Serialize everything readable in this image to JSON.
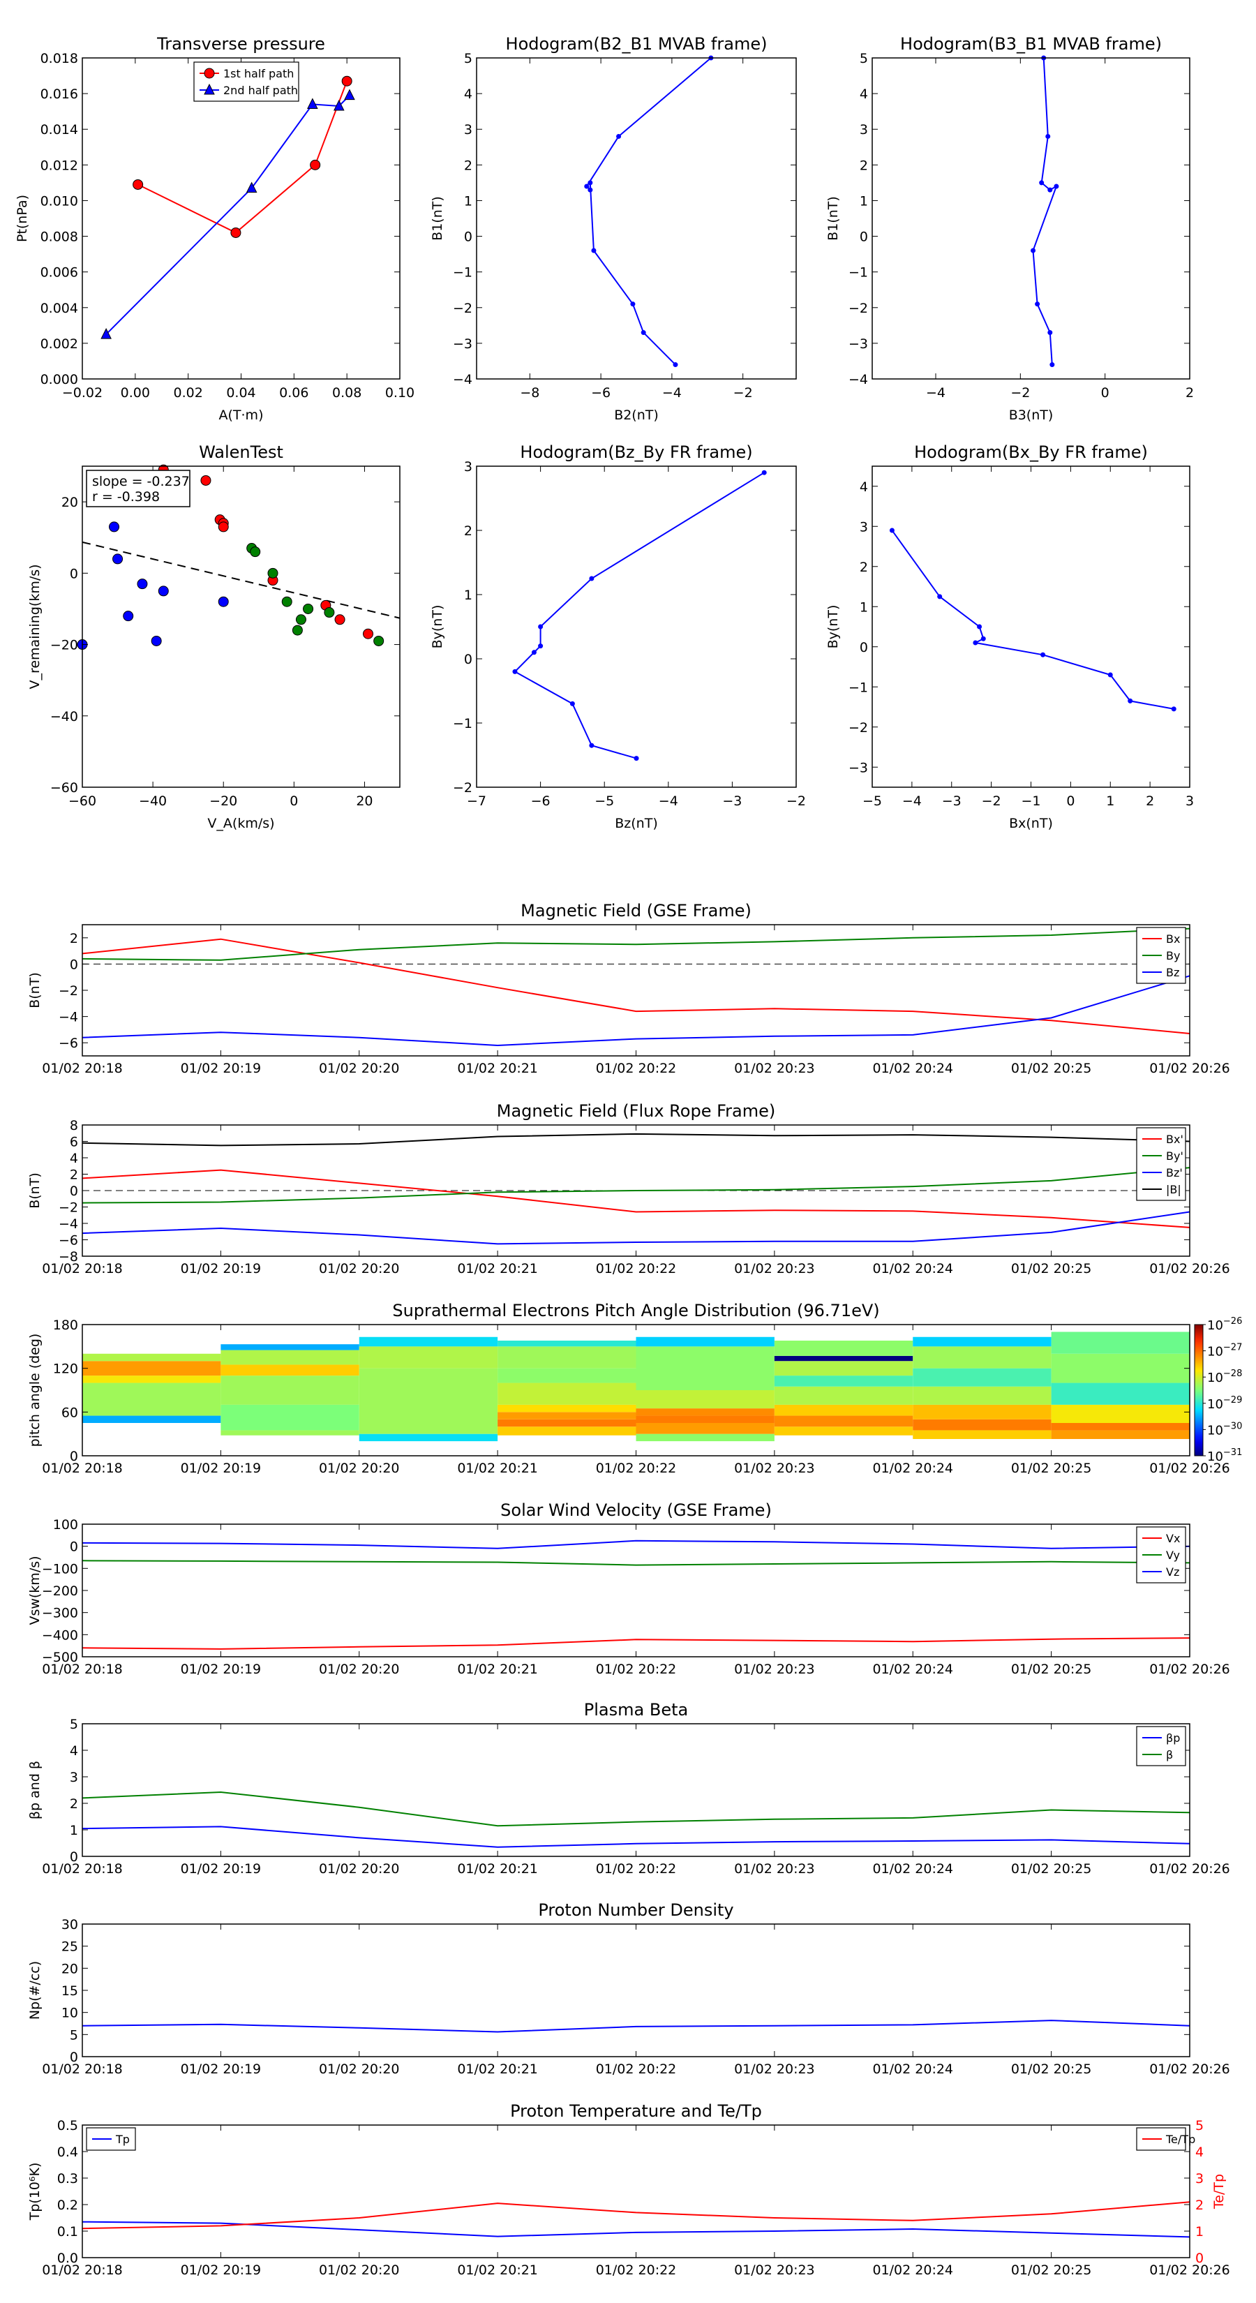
{
  "chart_data": [
    {
      "id": "tp",
      "type": "line",
      "title": "Transverse pressure",
      "xlabel": "A(T·m)",
      "ylabel": "Pt(nPa)",
      "xlim": [
        -0.02,
        0.1
      ],
      "ylim": [
        0.0,
        0.018
      ],
      "xticks": [
        -0.02,
        0.0,
        0.02,
        0.04,
        0.06,
        0.08,
        0.1
      ],
      "yticks": [
        0.0,
        0.002,
        0.004,
        0.006,
        0.008,
        0.01,
        0.012,
        0.014,
        0.016,
        0.018
      ],
      "xdec": 2,
      "ydec": 3,
      "legend": "top-center",
      "series": [
        {
          "name": "1st half path",
          "color": "#ff0000",
          "marker": "circle",
          "x": [
            0.001,
            0.038,
            0.068,
            0.08
          ],
          "y": [
            0.0109,
            0.0082,
            0.012,
            0.0167
          ]
        },
        {
          "name": "2nd half path",
          "color": "#0000ff",
          "marker": "triangle",
          "x": [
            -0.011,
            0.044,
            0.067,
            0.077,
            0.081
          ],
          "y": [
            0.0025,
            0.0107,
            0.0154,
            0.0153,
            0.0159
          ]
        }
      ]
    },
    {
      "id": "hb2",
      "type": "line",
      "title": "Hodogram(B2_B1 MVAB frame)",
      "xlabel": "B2(nT)",
      "ylabel": "B1(nT)",
      "xlim": [
        -9.5,
        -0.5
      ],
      "ylim": [
        -4,
        5
      ],
      "xticks": [
        -8,
        -6,
        -4,
        -2
      ],
      "yticks": [
        -4,
        -3,
        -2,
        -1,
        0,
        1,
        2,
        3,
        4,
        5
      ],
      "xdec": 0,
      "ydec": 0,
      "series": [
        {
          "name": "",
          "color": "#0000ff",
          "marker": "dot",
          "x": [
            -2.9,
            -5.5,
            -6.4,
            -6.3,
            -6.3,
            -6.2,
            -5.1,
            -4.8,
            -3.9
          ],
          "y": [
            5.0,
            2.8,
            1.4,
            1.3,
            1.5,
            -0.4,
            -1.9,
            -2.7,
            -3.6
          ]
        }
      ]
    },
    {
      "id": "hb3",
      "type": "line",
      "title": "Hodogram(B3_B1 MVAB frame)",
      "xlabel": "B3(nT)",
      "ylabel": "B1(nT)",
      "xlim": [
        -5.5,
        2.0
      ],
      "ylim": [
        -4,
        5
      ],
      "xticks": [
        -4,
        -2,
        0,
        2
      ],
      "yticks": [
        -4,
        -3,
        -2,
        -1,
        0,
        1,
        2,
        3,
        4,
        5
      ],
      "xdec": 0,
      "ydec": 0,
      "series": [
        {
          "name": "",
          "color": "#0000ff",
          "marker": "dot",
          "x": [
            -1.45,
            -1.35,
            -1.5,
            -1.3,
            -1.15,
            -1.7,
            -1.6,
            -1.3,
            -1.25
          ],
          "y": [
            5.0,
            2.8,
            1.5,
            1.3,
            1.4,
            -0.4,
            -1.9,
            -2.7,
            -3.6
          ]
        }
      ]
    },
    {
      "id": "walen",
      "type": "scatter",
      "title": "WalenTest",
      "xlabel": "V_A(km/s)",
      "ylabel": "V_remaining(km/s)",
      "xlim": [
        -60,
        30
      ],
      "ylim": [
        -60,
        30
      ],
      "xticks": [
        -60,
        -40,
        -20,
        0,
        20
      ],
      "yticks": [
        -60,
        -40,
        -20,
        0,
        20
      ],
      "xdec": 0,
      "ydec": 0,
      "annotation": [
        "slope = -0.237",
        "r = -0.398"
      ],
      "fit": {
        "slope": -0.237,
        "x": [
          -60,
          30
        ],
        "y": [
          8.7,
          -12.6
        ]
      },
      "series": [
        {
          "name": "",
          "color": "#ff0000",
          "marker": "circle",
          "x": [
            -37,
            -25,
            -21,
            -20,
            -20,
            -6,
            9,
            13,
            21
          ],
          "y": [
            29,
            26,
            15,
            14,
            13,
            -2,
            -9,
            -13,
            -17
          ]
        },
        {
          "name": "",
          "color": "#0000ff",
          "marker": "circle",
          "x": [
            -60,
            -51,
            -50,
            -47,
            -43,
            -39,
            -37,
            -20
          ],
          "y": [
            -20,
            13,
            4,
            -12,
            -3,
            -19,
            -5,
            -8
          ]
        },
        {
          "name": "",
          "color": "#008000",
          "marker": "circle",
          "x": [
            -12,
            -11,
            -6,
            -2,
            1,
            2,
            4,
            10,
            24
          ],
          "y": [
            7,
            6,
            0,
            -8,
            -16,
            -13,
            -10,
            -11,
            -19
          ]
        }
      ]
    },
    {
      "id": "hbz",
      "type": "line",
      "title": "Hodogram(Bz_By FR frame)",
      "xlabel": "Bz(nT)",
      "ylabel": "By(nT)",
      "xlim": [
        -7,
        -2
      ],
      "ylim": [
        -2,
        3
      ],
      "xticks": [
        -7,
        -6,
        -5,
        -4,
        -3,
        -2
      ],
      "yticks": [
        -2,
        -1,
        0,
        1,
        2,
        3
      ],
      "xdec": 0,
      "ydec": 0,
      "series": [
        {
          "name": "",
          "color": "#0000ff",
          "marker": "dot",
          "x": [
            -2.5,
            -5.2,
            -6.0,
            -6.0,
            -6.1,
            -6.4,
            -5.5,
            -5.2,
            -4.5
          ],
          "y": [
            2.9,
            1.25,
            0.5,
            0.2,
            0.1,
            -0.2,
            -0.7,
            -1.35,
            -1.55
          ]
        }
      ]
    },
    {
      "id": "hbx",
      "type": "line",
      "title": "Hodogram(Bx_By FR frame)",
      "xlabel": "Bx(nT)",
      "ylabel": "By(nT)",
      "xlim": [
        -5,
        3
      ],
      "ylim": [
        -3.5,
        4.5
      ],
      "xticks": [
        -5,
        -4,
        -3,
        -2,
        -1,
        0,
        1,
        2,
        3
      ],
      "yticks": [
        -3,
        -2,
        -1,
        0,
        1,
        2,
        3,
        4
      ],
      "xdec": 0,
      "ydec": 0,
      "series": [
        {
          "name": "",
          "color": "#0000ff",
          "marker": "dot",
          "x": [
            -4.5,
            -3.3,
            -2.3,
            -2.2,
            -2.4,
            -0.7,
            1.0,
            1.5,
            2.6
          ],
          "y": [
            2.9,
            1.25,
            0.5,
            0.2,
            0.1,
            -0.2,
            -0.7,
            -1.35,
            -1.55
          ]
        }
      ]
    },
    {
      "id": "bgse",
      "type": "line",
      "title": "Magnetic Field (GSE Frame)",
      "ylabel": "B(nT)",
      "xlim": [
        0,
        8
      ],
      "ylim": [
        -7,
        3
      ],
      "yticks": [
        -6,
        -4,
        -2,
        0,
        2
      ],
      "ydec": 0,
      "zero_line": true,
      "legend": "top-right",
      "series": [
        {
          "name": "Bx",
          "color": "#ff0000",
          "y": [
            0.8,
            1.9,
            0.1,
            -1.8,
            -3.6,
            -3.4,
            -3.6,
            -4.3,
            -5.3
          ]
        },
        {
          "name": "By",
          "color": "#008000",
          "y": [
            0.4,
            0.3,
            1.1,
            1.6,
            1.5,
            1.7,
            2.0,
            2.2,
            2.7
          ]
        },
        {
          "name": "Bz",
          "color": "#0000ff",
          "y": [
            -5.6,
            -5.2,
            -5.6,
            -6.2,
            -5.7,
            -5.5,
            -5.4,
            -4.1,
            -0.9
          ]
        }
      ]
    },
    {
      "id": "bfr",
      "type": "line",
      "title": "Magnetic Field (Flux Rope Frame)",
      "ylabel": "B(nT)",
      "xlim": [
        0,
        8
      ],
      "ylim": [
        -8,
        8
      ],
      "yticks": [
        -8,
        -6,
        -4,
        -2,
        0,
        2,
        4,
        6,
        8
      ],
      "ydec": 0,
      "zero_line": true,
      "legend": "top-right",
      "series": [
        {
          "name": "Bx'",
          "color": "#ff0000",
          "y": [
            1.5,
            2.5,
            0.9,
            -0.7,
            -2.6,
            -2.4,
            -2.5,
            -3.3,
            -4.5
          ]
        },
        {
          "name": "By'",
          "color": "#008000",
          "y": [
            -1.5,
            -1.4,
            -0.9,
            -0.2,
            0.0,
            0.1,
            0.5,
            1.2,
            2.8
          ]
        },
        {
          "name": "Bz'",
          "color": "#0000ff",
          "y": [
            -5.2,
            -4.6,
            -5.4,
            -6.5,
            -6.3,
            -6.2,
            -6.2,
            -5.1,
            -2.6
          ]
        },
        {
          "name": "|B|",
          "color": "#000000",
          "y": [
            5.8,
            5.5,
            5.7,
            6.6,
            6.9,
            6.7,
            6.8,
            6.5,
            6.0
          ]
        }
      ]
    },
    {
      "id": "pad",
      "type": "heatmap",
      "title": "Suprathermal Electrons Pitch Angle Distribution (96.71eV)",
      "ylabel": "pitch angle (deg)",
      "xlim": [
        0,
        8
      ],
      "ylim": [
        0,
        180
      ],
      "yticks": [
        0,
        60,
        120,
        180
      ],
      "ydec": 0,
      "colorbar": {
        "min_exp": -31,
        "max_exp": -26,
        "ticks": [
          -31,
          -30,
          -29,
          -28,
          -27,
          -26
        ]
      },
      "columns": [
        {
          "ymin": 45,
          "ymax": 140,
          "bands": [
            [
              45,
              55,
              -29.5
            ],
            [
              55,
              100,
              -28.3
            ],
            [
              100,
              110,
              -27.8
            ],
            [
              110,
              130,
              -27.3
            ],
            [
              130,
              140,
              -28.2
            ]
          ]
        },
        {
          "ymin": 28,
          "ymax": 153,
          "bands": [
            [
              28,
              35,
              -28.3
            ],
            [
              35,
              70,
              -28.5
            ],
            [
              70,
              110,
              -28.3
            ],
            [
              110,
              125,
              -27.6
            ],
            [
              125,
              145,
              -28.2
            ],
            [
              145,
              153,
              -29.5
            ]
          ]
        },
        {
          "ymin": 20,
          "ymax": 163,
          "bands": [
            [
              20,
              30,
              -29.2
            ],
            [
              30,
              120,
              -28.3
            ],
            [
              120,
              150,
              -28.2
            ],
            [
              150,
              163,
              -29.2
            ]
          ]
        },
        {
          "ymin": 28,
          "ymax": 158,
          "bands": [
            [
              28,
              40,
              -27.6
            ],
            [
              40,
              50,
              -27.1
            ],
            [
              50,
              60,
              -27.3
            ],
            [
              60,
              70,
              -27.7
            ],
            [
              70,
              100,
              -28.1
            ],
            [
              100,
              120,
              -28.4
            ],
            [
              120,
              150,
              -28.3
            ],
            [
              150,
              158,
              -29.0
            ]
          ]
        },
        {
          "ymin": 20,
          "ymax": 163,
          "bands": [
            [
              20,
              30,
              -28.4
            ],
            [
              30,
              45,
              -27.3
            ],
            [
              45,
              55,
              -27.1
            ],
            [
              55,
              65,
              -27.2
            ],
            [
              65,
              90,
              -28.1
            ],
            [
              90,
              150,
              -28.4
            ],
            [
              150,
              163,
              -29.3
            ]
          ]
        },
        {
          "ymin": 28,
          "ymax": 158,
          "bands": [
            [
              28,
              40,
              -27.6
            ],
            [
              40,
              55,
              -27.2
            ],
            [
              55,
              70,
              -27.6
            ],
            [
              70,
              95,
              -28.2
            ],
            [
              95,
              110,
              -28.8
            ],
            [
              110,
              130,
              -28.2
            ],
            [
              130,
              137,
              -31.0
            ],
            [
              137,
              158,
              -28.4
            ]
          ]
        },
        {
          "ymin": 23,
          "ymax": 163,
          "bands": [
            [
              23,
              35,
              -27.6
            ],
            [
              35,
              50,
              -27.1
            ],
            [
              50,
              70,
              -27.5
            ],
            [
              70,
              95,
              -28.2
            ],
            [
              95,
              120,
              -28.8
            ],
            [
              120,
              150,
              -28.3
            ],
            [
              150,
              163,
              -29.3
            ]
          ]
        },
        {
          "ymin": 23,
          "ymax": 170,
          "bands": [
            [
              23,
              35,
              -27.3
            ],
            [
              35,
              45,
              -27.1
            ],
            [
              45,
              70,
              -27.8
            ],
            [
              70,
              100,
              -28.9
            ],
            [
              100,
              140,
              -28.4
            ],
            [
              140,
              170,
              -28.6
            ]
          ]
        }
      ]
    },
    {
      "id": "vsw",
      "type": "line",
      "title": "Solar Wind Velocity (GSE Frame)",
      "ylabel": "Vsw(km/s)",
      "xlim": [
        0,
        8
      ],
      "ylim": [
        -500,
        100
      ],
      "yticks": [
        -500,
        -400,
        -300,
        -200,
        -100,
        0,
        100
      ],
      "ydec": 0,
      "legend": "top-right",
      "series": [
        {
          "name": "Vx",
          "color": "#ff0000",
          "y": [
            -460,
            -465,
            -455,
            -447,
            -422,
            -426,
            -431,
            -420,
            -415
          ]
        },
        {
          "name": "Vy",
          "color": "#008000",
          "y": [
            -65,
            -67,
            -70,
            -72,
            -85,
            -80,
            -75,
            -70,
            -75
          ]
        },
        {
          "name": "Vz",
          "color": "#0000ff",
          "y": [
            15,
            13,
            5,
            -10,
            25,
            20,
            10,
            -10,
            0
          ]
        }
      ]
    },
    {
      "id": "beta",
      "type": "line",
      "title": "Plasma Beta",
      "ylabel": "βp and β",
      "xlim": [
        0,
        8
      ],
      "ylim": [
        0,
        5
      ],
      "yticks": [
        0,
        1,
        2,
        3,
        4,
        5
      ],
      "ydec": 0,
      "legend": "top-right",
      "series": [
        {
          "name": "βp",
          "color": "#0000ff",
          "y": [
            1.05,
            1.12,
            0.7,
            0.35,
            0.48,
            0.55,
            0.58,
            0.62,
            0.48
          ]
        },
        {
          "name": "β",
          "color": "#008000",
          "y": [
            2.2,
            2.42,
            1.85,
            1.15,
            1.3,
            1.4,
            1.45,
            1.75,
            1.65
          ]
        }
      ]
    },
    {
      "id": "np",
      "type": "line",
      "title": "Proton Number Density",
      "ylabel": "Np(#/cc)",
      "xlim": [
        0,
        8
      ],
      "ylim": [
        0,
        30
      ],
      "yticks": [
        0,
        5,
        10,
        15,
        20,
        25,
        30
      ],
      "ydec": 0,
      "series": [
        {
          "name": "",
          "color": "#0000ff",
          "y": [
            7.0,
            7.3,
            6.5,
            5.6,
            6.8,
            7.0,
            7.2,
            8.2,
            7.0
          ]
        }
      ]
    },
    {
      "id": "temp",
      "type": "line",
      "title": "Proton Temperature and Te/Tp",
      "ylabel": "Tp(10⁶K)",
      "ylabel2": "Te/Tp",
      "xlim": [
        0,
        8
      ],
      "ylim": [
        0,
        0.5
      ],
      "ylim2": [
        0,
        5
      ],
      "yticks": [
        0,
        0.1,
        0.2,
        0.3,
        0.4,
        0.5
      ],
      "yticks2": [
        0,
        1,
        2,
        3,
        4,
        5
      ],
      "ydec": 1,
      "ydec2": 0,
      "legend": "top-left",
      "legend2": "top-right",
      "series": [
        {
          "name": "Tp",
          "color": "#0000ff",
          "axis": "left",
          "y": [
            0.135,
            0.13,
            0.105,
            0.08,
            0.095,
            0.1,
            0.108,
            0.093,
            0.078
          ]
        },
        {
          "name": "Te/Tp",
          "color": "#ff0000",
          "axis": "right",
          "y": [
            1.1,
            1.2,
            1.5,
            2.05,
            1.7,
            1.5,
            1.4,
            1.65,
            2.1
          ]
        }
      ]
    }
  ],
  "time_labels": [
    "01/02 20:18",
    "01/02 20:19",
    "01/02 20:20",
    "01/02 20:21",
    "01/02 20:22",
    "01/02 20:23",
    "01/02 20:24",
    "01/02 20:25",
    "01/02 20:26"
  ]
}
